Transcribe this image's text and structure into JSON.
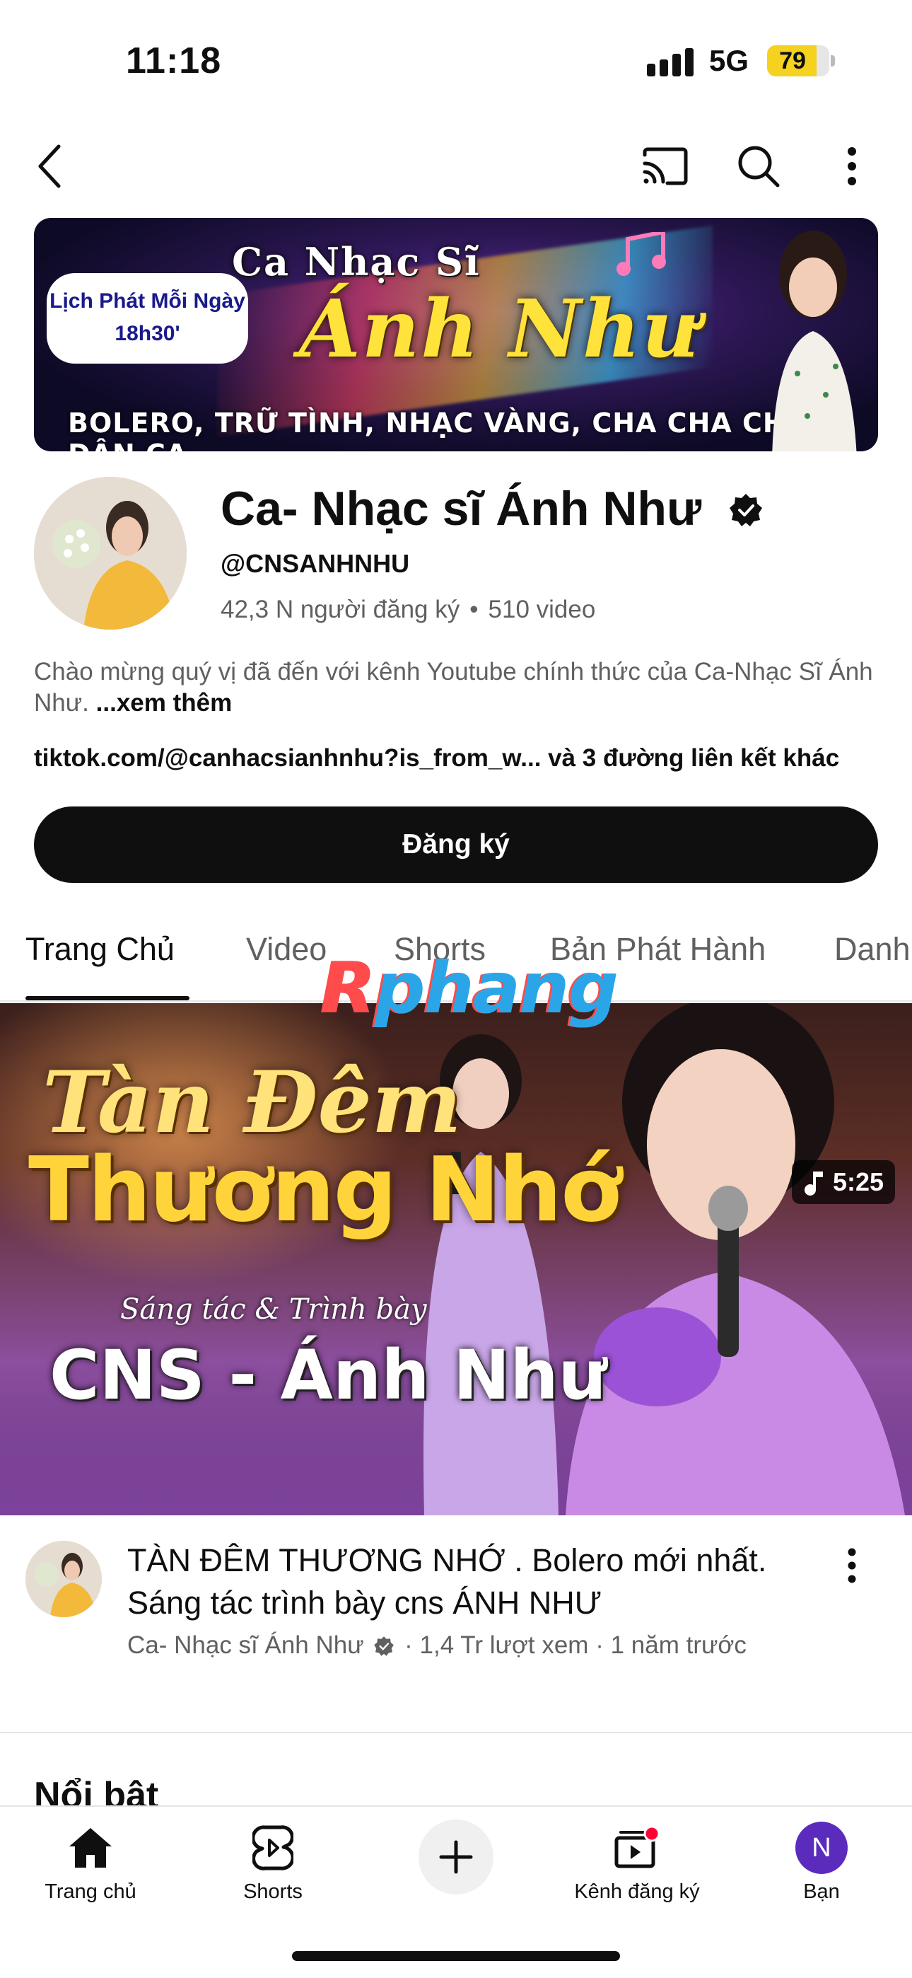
{
  "status_bar": {
    "time": "11:18",
    "network": "5G",
    "battery": "79",
    "battery_level": 0.79,
    "battery_color": "#f4d21f"
  },
  "top_nav": {
    "icons": [
      "back-arrow-icon",
      "cast-icon",
      "search-icon",
      "more-vert-icon"
    ]
  },
  "banner": {
    "badge_line1": "Lịch Phát Mỗi Ngày",
    "badge_line2": "18h30'",
    "title": "Ca Nhạc Sĩ",
    "script_name": "Ánh Như",
    "bottom_text": "BOLERO, TRỮ TÌNH, NHẠC VÀNG, CHA CHA CHA, DÂN CA..."
  },
  "channel": {
    "name": "Ca- Nhạc sĩ Ánh Như",
    "handle": "@CNSANHNHU",
    "subscribers": "42,3 N người đăng ký",
    "separator": "•",
    "video_count": "510 video",
    "description": "Chào mừng quý vị đã đến với kênh Youtube chính thức của Ca-Nhạc Sĩ Ánh Như.",
    "see_more": "...xem thêm",
    "link": "tiktok.com/@canhacsianhnhu?is_from_w... và 3 đường liên kết khác",
    "subscribe_label": "Đăng ký"
  },
  "tabs": [
    {
      "label": "Trang Chủ",
      "active": true
    },
    {
      "label": "Video",
      "active": false
    },
    {
      "label": "Shorts",
      "active": false
    },
    {
      "label": "Bản Phát Hành",
      "active": false
    },
    {
      "label": "Danh",
      "active": false
    }
  ],
  "watermark": {
    "part1": "R",
    "part2": "phang"
  },
  "video": {
    "thumb_line1": "Tàn Đêm",
    "thumb_line2": "Thương Nhớ",
    "thumb_line3": "Sáng tác & Trình bày",
    "thumb_line4": "CNS - Ánh Như",
    "duration": "5:25",
    "title": "TÀN ĐÊM THƯƠNG NHỚ  . Bolero mới nhất. Sáng tác trình bày cns ÁNH NHƯ",
    "channel": "Ca- Nhạc sĩ Ánh Như",
    "views": "1,4 Tr lượt xem",
    "age": "1 năm trước",
    "meta_sep": "·"
  },
  "section": {
    "title": "Nổi bật"
  },
  "bottom_nav": [
    {
      "label": "Trang chủ",
      "icon": "home-icon"
    },
    {
      "label": "Shorts",
      "icon": "shorts-icon"
    },
    {
      "label": "",
      "icon": "create-plus-icon"
    },
    {
      "label": "Kênh đăng ký",
      "icon": "subscriptions-icon"
    },
    {
      "label": "Bạn",
      "icon": "avatar-icon",
      "initial": "N"
    }
  ],
  "colors": {
    "accent_red": "#ff0000",
    "subscribe_bg": "#0f0f0f",
    "avatar_me": "#5b2bbd"
  }
}
